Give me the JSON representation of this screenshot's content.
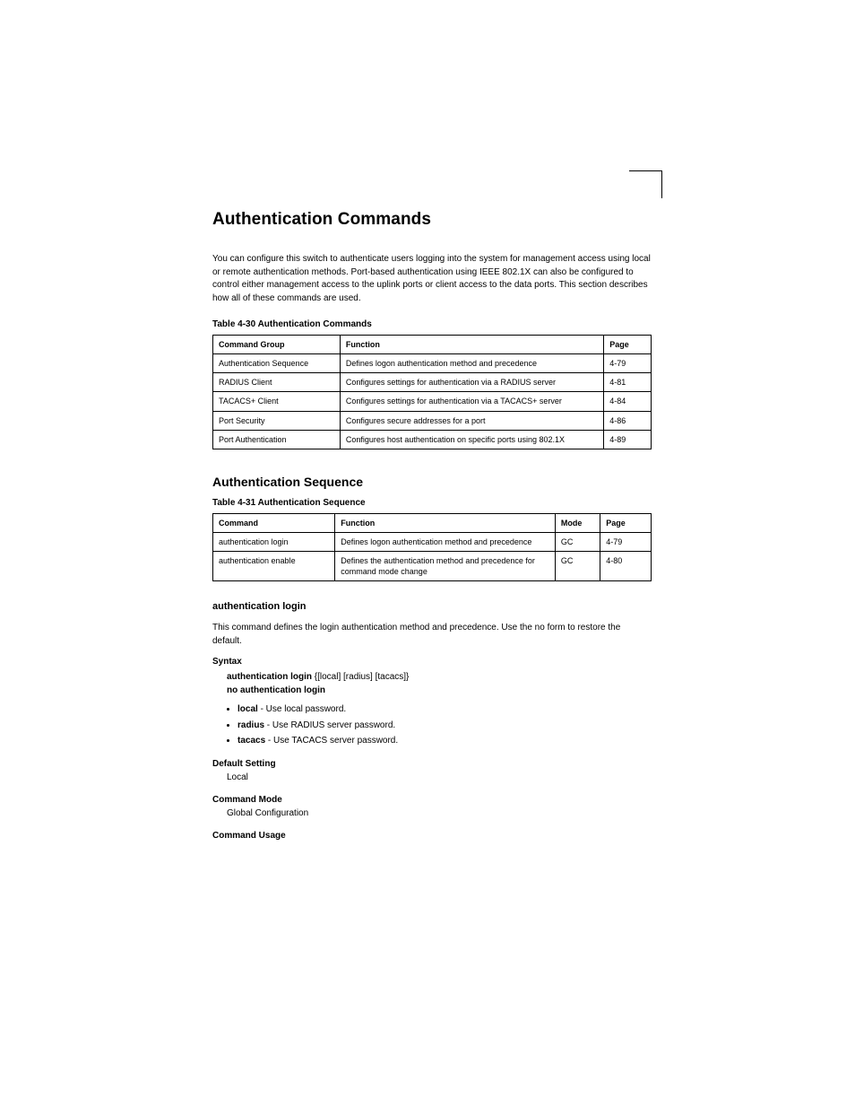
{
  "title": "Authentication Commands",
  "intro": "You can configure this switch to authenticate users logging into the system for management access using local or remote authentication methods. Port-based authentication using IEEE 802.1X can also be configured to control either management access to the uplink ports or client access to the data ports. This section describes how all of these commands are used.",
  "table1": {
    "caption": "Table 4-30  Authentication Commands",
    "headers": [
      "Command Group",
      "Function",
      "Page"
    ],
    "rows": [
      [
        "Authentication Sequence",
        "Defines logon authentication method and precedence",
        "4-79"
      ],
      [
        "RADIUS Client",
        "Configures settings for authentication via a RADIUS server",
        "4-81"
      ],
      [
        "TACACS+ Client",
        "Configures settings for authentication via a TACACS+ server",
        "4-84"
      ],
      [
        "Port Security",
        "Configures secure addresses for a port",
        "4-86"
      ],
      [
        "Port Authentication",
        "Configures host authentication on specific ports using 802.1X",
        "4-89"
      ]
    ]
  },
  "seq_heading": "Authentication Sequence",
  "table2": {
    "caption": "Table 4-31  Authentication Sequence",
    "headers": [
      "Command",
      "Function",
      "Mode",
      "Page"
    ],
    "rows": [
      [
        "authentication login",
        "Defines logon authentication method and precedence",
        "GC",
        "4-79"
      ],
      [
        "authentication enable",
        "Defines the authentication method and precedence for command mode change",
        "GC",
        "4-80"
      ]
    ]
  },
  "cmd_heading": "authentication login",
  "cmd_desc": "This command defines the login authentication method and precedence. Use the no form to restore the default.",
  "syntax_label": "Syntax",
  "syntax1_prefix": "authentication login",
  "syntax1_args": "{[local] [radius] [tacacs]}",
  "syntax2_prefix": "no authentication login",
  "args": [
    {
      "kw": "local",
      "desc": " - Use local password."
    },
    {
      "kw": "radius",
      "desc": " - Use RADIUS server password."
    },
    {
      "kw": "tacacs",
      "desc": " - Use TACACS server password."
    }
  ],
  "default_label": "Default Setting",
  "default_text": "Local",
  "cmdmode_label": "Command Mode",
  "cmdmode_text": "Global Configuration",
  "usage_label": "Command Usage"
}
